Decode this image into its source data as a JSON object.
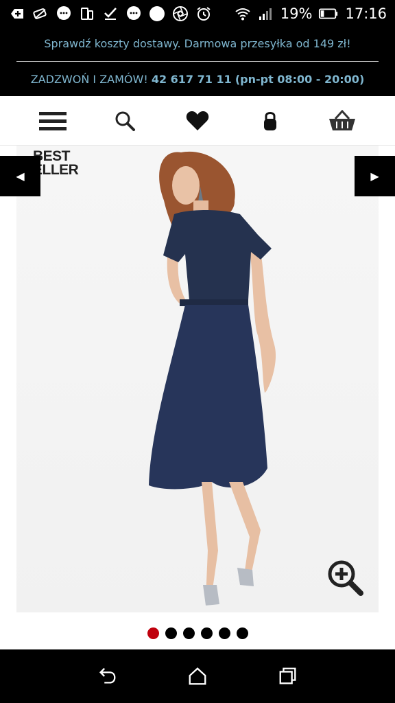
{
  "status": {
    "battery": "19%",
    "time": "17:16",
    "icons": [
      "add-icon",
      "battery-saver-icon",
      "chat-icon",
      "tablet-icon",
      "check-icon",
      "chat-icon",
      "circle-icon",
      "aperture-icon",
      "alarm-icon",
      "wifi-icon",
      "signal-icon",
      "battery-icon"
    ]
  },
  "promo": {
    "shipping": "Sprawdź koszty dostawy. Darmowa przesyłka od 149 zł!",
    "call_prefix": "ZADZWOŃ I ZAMÓW!",
    "phone": "42 617 71 11",
    "hours": "(pn-pt 08:00 - 20:00)",
    "text_color": "#7fb6cf"
  },
  "nav": {
    "items": [
      "menu-icon",
      "search-icon",
      "heart-icon",
      "lock-icon",
      "basket-icon"
    ]
  },
  "product": {
    "badge_line1": "BEST",
    "badge_line2": "ELLER",
    "prev_arrow": "◀",
    "next_arrow": "▶",
    "gallery": {
      "total_images": 6,
      "active_index": 0
    },
    "active_dot_color": "#c0000d"
  },
  "sysnav": [
    "back-icon",
    "home-icon",
    "recent-apps-icon"
  ]
}
